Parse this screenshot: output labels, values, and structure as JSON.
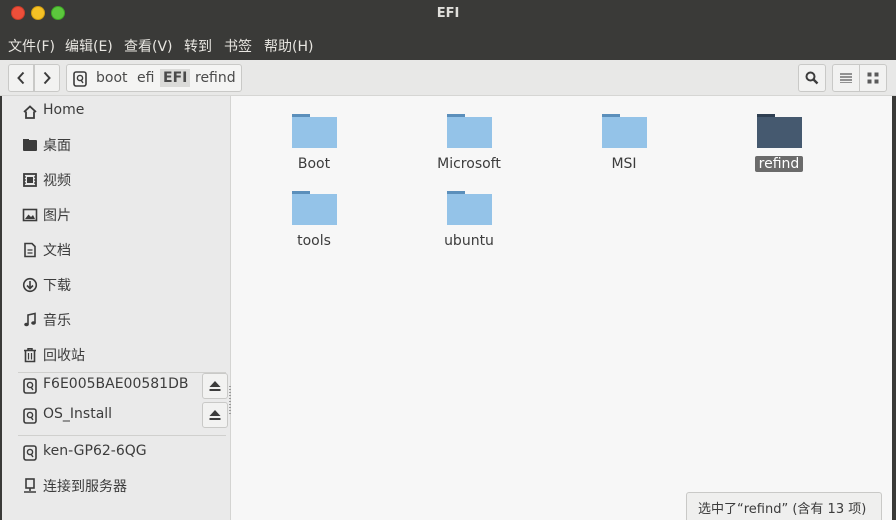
{
  "window": {
    "title": "EFI"
  },
  "menu": [
    "文件(F)",
    "编辑(E)",
    "查看(V)",
    "转到",
    "书签",
    "帮助(H)"
  ],
  "path": [
    "boot",
    "efi",
    "EFI",
    "refind"
  ],
  "sidebar": {
    "places": [
      {
        "label": "Home",
        "icon": "home-icon"
      },
      {
        "label": "桌面",
        "icon": "desktop-folder-icon"
      },
      {
        "label": "视频",
        "icon": "video-icon"
      },
      {
        "label": "图片",
        "icon": "picture-icon"
      },
      {
        "label": "文档",
        "icon": "document-icon"
      },
      {
        "label": "下载",
        "icon": "download-icon"
      },
      {
        "label": "音乐",
        "icon": "music-icon"
      },
      {
        "label": "回收站",
        "icon": "trash-icon"
      }
    ],
    "devices": [
      {
        "label": "F6E005BAE00581DB",
        "icon": "drive-icon",
        "ejectable": true
      },
      {
        "label": "OS_Install",
        "icon": "drive-icon",
        "ejectable": true
      }
    ],
    "network": [
      {
        "label": "ken-GP62-6QG",
        "icon": "drive-icon"
      },
      {
        "label": "连接到服务器",
        "icon": "network-server-icon"
      }
    ]
  },
  "folders": [
    {
      "name": "Boot",
      "selected": false
    },
    {
      "name": "Microsoft",
      "selected": false
    },
    {
      "name": "MSI",
      "selected": false
    },
    {
      "name": "refind",
      "selected": true
    },
    {
      "name": "tools",
      "selected": false
    },
    {
      "name": "ubuntu",
      "selected": false
    }
  ],
  "status": "选中了“refind” (含有 13 项)",
  "colors": {
    "folder": "#94c3e8",
    "folder_tab": "#5b8fbb",
    "folder_selected": "#45596f",
    "titlebar": "#3a3a38"
  }
}
